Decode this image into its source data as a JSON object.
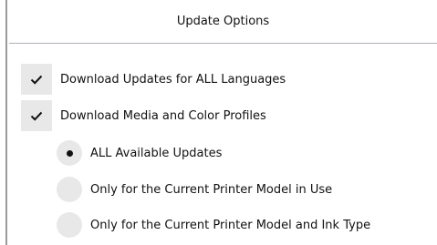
{
  "panel": {
    "title": "Update Options"
  },
  "checkboxes": [
    {
      "label": "Download Updates for ALL Languages",
      "checked": true
    },
    {
      "label": "Download Media and Color Profiles",
      "checked": true
    }
  ],
  "radio_group": {
    "options": [
      {
        "label": "ALL Available Updates",
        "selected": true
      },
      {
        "label": "Only for the Current Printer Model in Use",
        "selected": false
      },
      {
        "label": "Only for the Current Printer Model and Ink Type",
        "selected": false
      }
    ]
  },
  "icons": {
    "check": "checkmark-icon",
    "radio_selected": "radio-dot-icon"
  },
  "colors": {
    "control_bg": "#e8e8e8",
    "header_border": "#9ab6d8",
    "frame_border": "#9a9a9a"
  }
}
